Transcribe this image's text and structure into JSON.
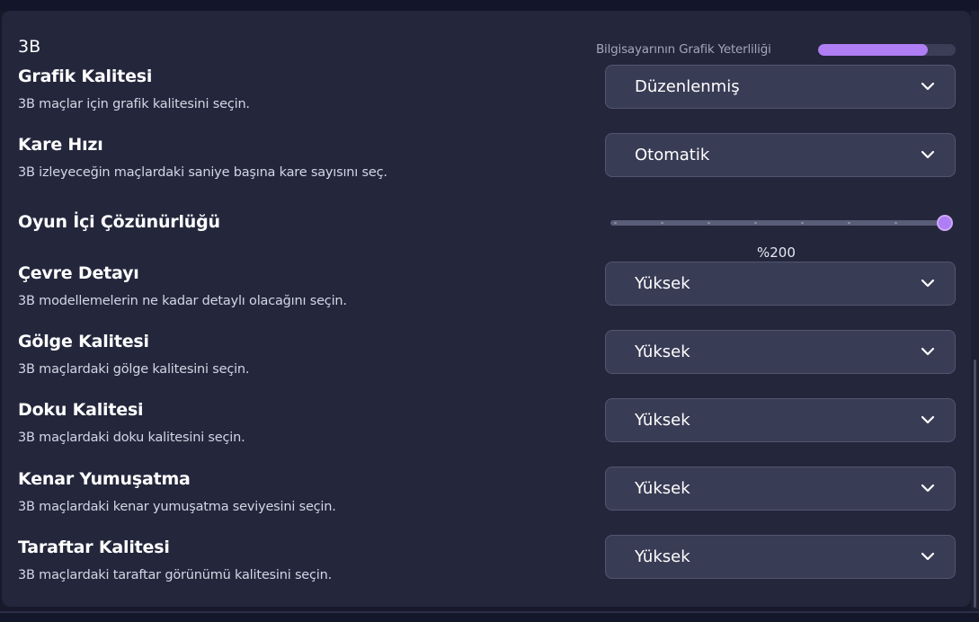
{
  "section": {
    "title": "3B",
    "gpu_label": "Bilgisayarının Grafik Yeterliliği",
    "gpu_fraction": 0.8
  },
  "settings": {
    "graphics_quality": {
      "title": "Grafik Kalitesi",
      "desc": "3B maçlar için grafik kalitesini seçin.",
      "value": "Düzenlenmiş"
    },
    "frame_rate": {
      "title": "Kare Hızı",
      "desc": "3B izleyeceğin maçlardaki saniye başına kare sayısını seç.",
      "value": "Otomatik"
    },
    "resolution": {
      "title": "Oyun İçi Çözünürlüğü",
      "value_label": "%200",
      "fraction": 1.0,
      "ticks": 8
    },
    "environment_detail": {
      "title": "Çevre Detayı",
      "desc": "3B modellemelerin ne kadar detaylı olacağını seçin.",
      "value": "Yüksek"
    },
    "shadow_quality": {
      "title": "Gölge Kalitesi",
      "desc": "3B maçlardaki gölge kalitesini seçin.",
      "value": "Yüksek"
    },
    "texture_quality": {
      "title": "Doku Kalitesi",
      "desc": "3B maçlardaki doku kalitesini seçin.",
      "value": "Yüksek"
    },
    "anti_aliasing": {
      "title": "Kenar Yumuşatma",
      "desc": "3B maçlardaki kenar yumuşatma seviyesini seçin.",
      "value": "Yüksek"
    },
    "crowd_quality": {
      "title": "Taraftar Kalitesi",
      "desc": "3B maçlardaki taraftar görünümü kalitesini seçin.",
      "value": "Yüksek"
    }
  },
  "colors": {
    "accent": "#b07ef4",
    "panel": "#24263c",
    "dropdown": "#393c55"
  },
  "icons": {
    "dropdown_chevron": "chevron-down-icon"
  }
}
